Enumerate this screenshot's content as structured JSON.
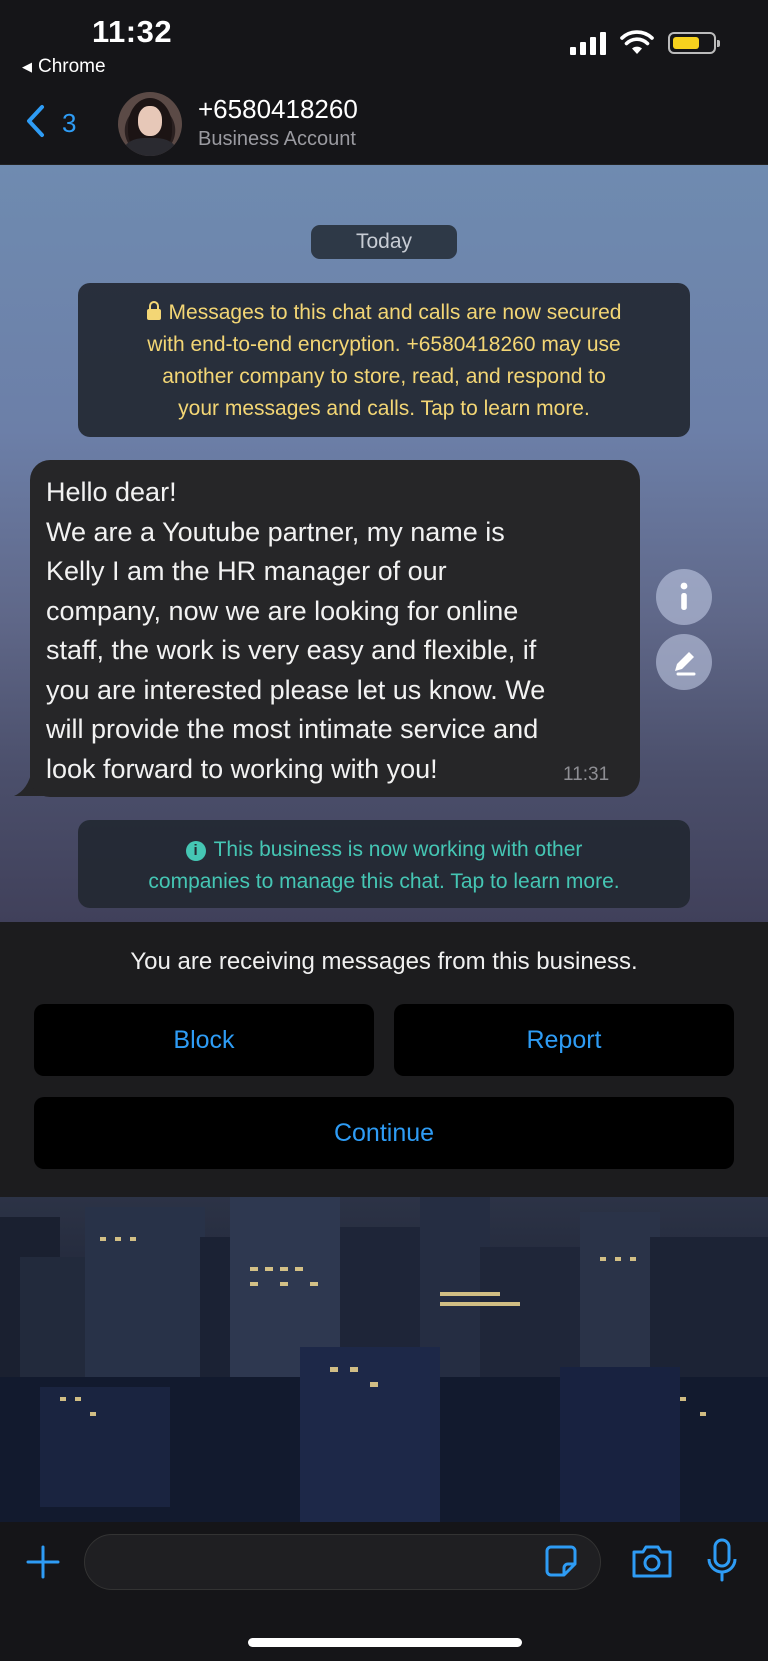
{
  "status_bar": {
    "time": "11:32",
    "back_app": "Chrome"
  },
  "header": {
    "unread_count": "3",
    "contact_name": "+6580418260",
    "contact_subtitle": "Business Account"
  },
  "chat": {
    "day_label": "Today",
    "encryption_notice": [
      "Messages to this chat and calls are now secured",
      "with end-to-end encryption. +6580418260 may use",
      "another company to store, read, and respond to",
      "your messages and calls. Tap to learn more."
    ],
    "message_lines": [
      "Hello dear!",
      "We are a Youtube partner, my name is",
      "Kelly I am the HR manager of our",
      "company, now we are looking for online",
      "staff, the work is very easy and flexible, if",
      "you are interested please let us know. We",
      "will provide the most intimate service and",
      "look forward to working with you!"
    ],
    "message_time": "11:31",
    "business_notice": [
      "This business is now working with other",
      "companies to manage this chat. Tap to learn more."
    ]
  },
  "business_panel": {
    "text": "You are receiving messages from this business.",
    "block_label": "Block",
    "report_label": "Report",
    "continue_label": "Continue"
  },
  "colors": {
    "accent_blue": "#2e9cf5",
    "notice_yellow": "#f3d675",
    "notice_teal": "#45c6b4",
    "battery_yellow": "#f7d21e"
  }
}
